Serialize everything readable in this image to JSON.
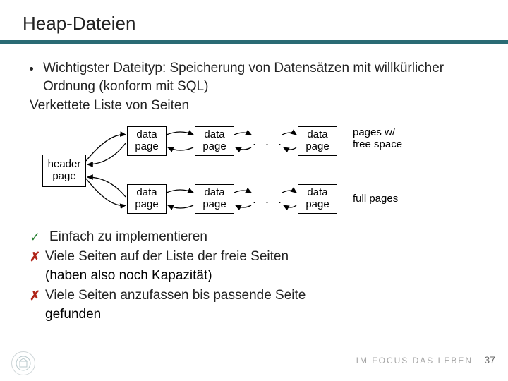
{
  "title": "Heap-Dateien",
  "bullet1": "Wichtigster Dateityp: Speicherung von Datensätzen mit willkürlicher Ordnung (konform mit SQL)",
  "subline": "Verkettete Liste von Seiten",
  "diagram": {
    "header": "header\npage",
    "data": "data\npage",
    "labelTop": "pages w/\nfree space",
    "labelBottom": "full pages",
    "dots": ". . ."
  },
  "checks": {
    "c1": "Einfach zu implementieren",
    "x1": "Viele Seiten auf der Liste der freie Seiten",
    "x1b": "(haben also noch Kapazität)",
    "x2": "Viele Seiten anzufassen bis passende Seite",
    "x2b": "gefunden"
  },
  "footer": {
    "brand": "IM FOCUS DAS LEBEN",
    "page": "37"
  }
}
